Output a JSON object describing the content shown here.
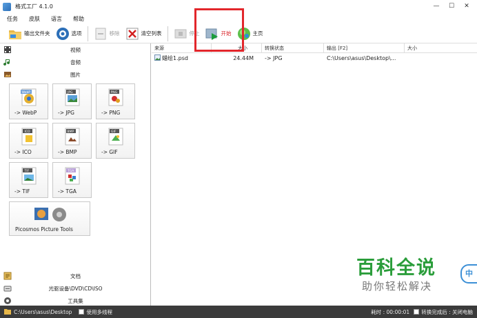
{
  "window": {
    "title": "格式工厂 4.1.0",
    "controls": [
      "—",
      "☐",
      "✕"
    ]
  },
  "menu": [
    "任务",
    "皮肤",
    "语言",
    "帮助"
  ],
  "toolbar": {
    "output_folder": "输出文件夹",
    "options": "选项",
    "remove": "移除",
    "clear_list": "清空列表",
    "stop": "停止",
    "start": "开始",
    "home": "主页"
  },
  "sidebar": {
    "categories_top": [
      "视频",
      "音频",
      "图片"
    ],
    "tiles": [
      "-> WebP",
      "-> JPG",
      "-> PNG",
      "-> ICO",
      "-> BMP",
      "-> GIF",
      "-> TIF",
      "-> TGA"
    ],
    "tile_badges": [
      "WebP",
      "JPG",
      "PNG",
      "ICO",
      "BMP",
      "GIF",
      "TIF",
      "TGA"
    ],
    "picosmos": "Picosmos Picture Tools",
    "categories_bottom": [
      "文档",
      "光驱设备\\DVD\\CD\\ISO",
      "工具集"
    ]
  },
  "file_table": {
    "headers": [
      "来源",
      "大小",
      "转换状态",
      "输出 [F2]",
      "大小"
    ],
    "rows": [
      {
        "source": "蜡绘1.psd",
        "size": "24.44M",
        "status": "-> JPG",
        "output": "C:\\Users\\asus\\Desktop\\...",
        "out_size": ""
      }
    ]
  },
  "statusbar": {
    "path": "C:\\Users\\asus\\Desktop",
    "multithread": "使用多线程",
    "elapsed": "耗时 : 00:00:01",
    "after_convert": "转换完成后 : 关闭电脑"
  },
  "watermark": {
    "title": "百科全说",
    "subtitle": "助你轻松解决",
    "badge": "中"
  },
  "colors": {
    "highlight": "#e2262b",
    "start_label": "#d9262b",
    "statusbar": "#3b3b3b",
    "watermark_green": "#2a9d3a"
  }
}
